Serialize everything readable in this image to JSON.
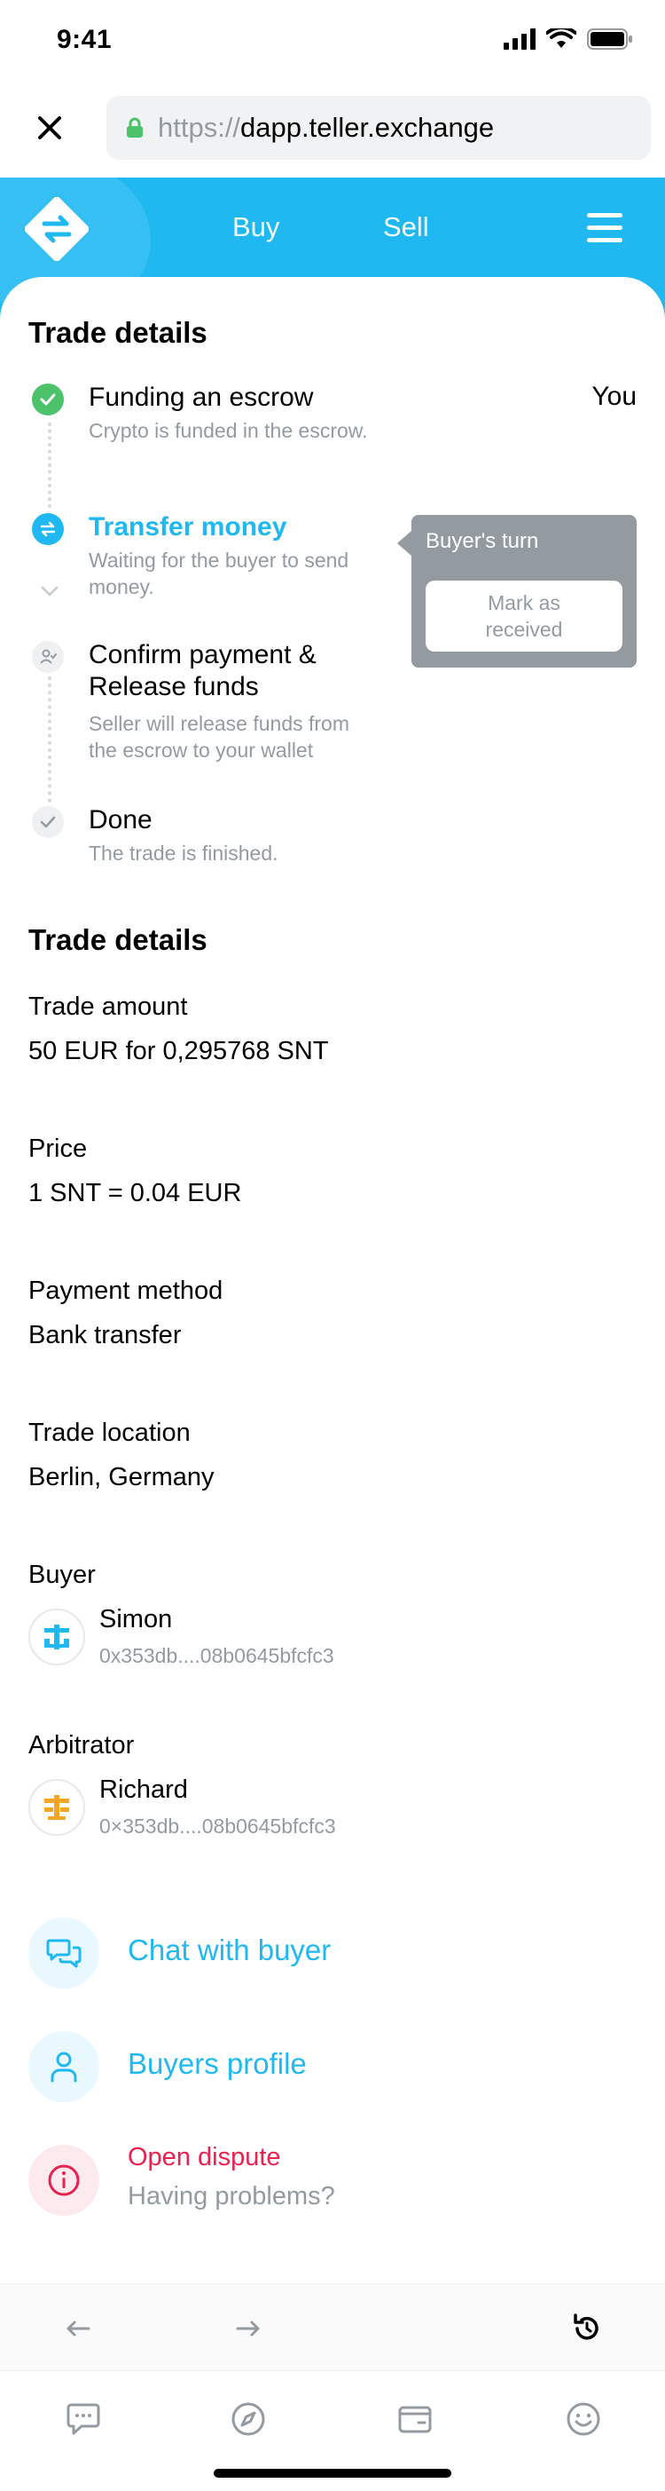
{
  "status_bar": {
    "time": "9:41"
  },
  "browser": {
    "url_protocol": "https://",
    "url_host": "dapp.teller.exchange"
  },
  "nav": {
    "buy": "Buy",
    "sell": "Sell"
  },
  "progress": {
    "title": "Trade details",
    "steps": [
      {
        "title": "Funding an escrow",
        "subtitle": "Crypto is funded in the escrow.",
        "badge": "You",
        "state": "done"
      },
      {
        "title": "Transfer money",
        "subtitle_line1": "Waiting for the buyer to send",
        "subtitle_line2": "money.",
        "state": "active"
      },
      {
        "title_line1": "Confirm payment &",
        "title_line2": "Release funds",
        "subtitle_line1": "Seller will release funds from",
        "subtitle_line2": "the escrow to your wallet",
        "state": "pending"
      },
      {
        "title": "Done",
        "subtitle": "The trade is finished.",
        "state": "pending"
      }
    ],
    "tooltip": {
      "title": "Buyer's turn",
      "button_line1": "Mark as",
      "button_line2": "received"
    }
  },
  "details": {
    "title": "Trade details",
    "trade_amount": {
      "label": "Trade amount",
      "value": "50 EUR for 0,295768 SNT"
    },
    "price": {
      "label": "Price",
      "value": "1 SNT = 0.04 EUR"
    },
    "payment_method": {
      "label": "Payment method",
      "value": "Bank transfer"
    },
    "trade_location": {
      "label": "Trade location",
      "value": "Berlin, Germany"
    },
    "buyer": {
      "label": "Buyer",
      "name": "Simon",
      "address": "0x353db....08b0645bfcfc3"
    },
    "arbitrator": {
      "label": "Arbitrator",
      "name": "Richard",
      "address": "0×353db....08b0645bfcfc3"
    }
  },
  "actions": {
    "chat": "Chat with buyer",
    "profile": "Buyers profile",
    "dispute": "Open dispute",
    "dispute_sub": "Having problems?"
  },
  "colors": {
    "accent": "#1fb8f1",
    "success": "#4cc26a",
    "danger": "#e8224f",
    "muted": "#939ba1",
    "buyer_avatar": "#1fb8f1",
    "arbitrator_avatar": "#f5a623"
  }
}
